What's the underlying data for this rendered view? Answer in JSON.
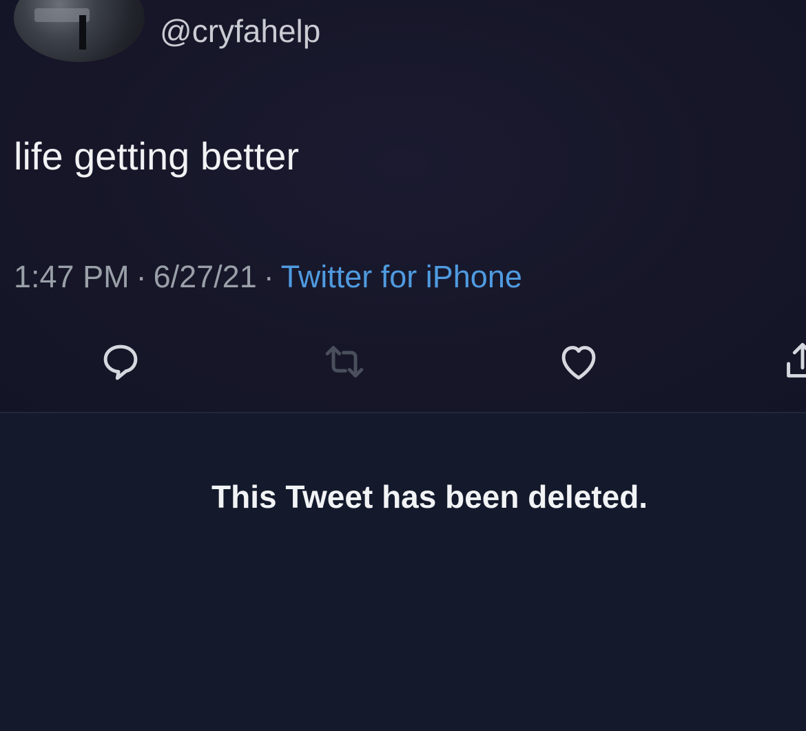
{
  "tweet": {
    "handle": "@cryfahelp",
    "text": "life getting better",
    "time": "1:47 PM",
    "separator_1": "·",
    "date": "6/27/21",
    "separator_2": "·",
    "source": "Twitter for iPhone"
  },
  "actions": [
    {
      "icon": "reply-icon"
    },
    {
      "icon": "retweet-icon"
    },
    {
      "icon": "heart-icon"
    },
    {
      "icon": "share-icon"
    }
  ],
  "deleted_notice": {
    "text": "This Tweet has been deleted."
  },
  "colors": {
    "background": "#15192b",
    "link": "#4f9be0",
    "icon": "#c9ccd3",
    "retweet_icon": "#4a4f5c"
  }
}
